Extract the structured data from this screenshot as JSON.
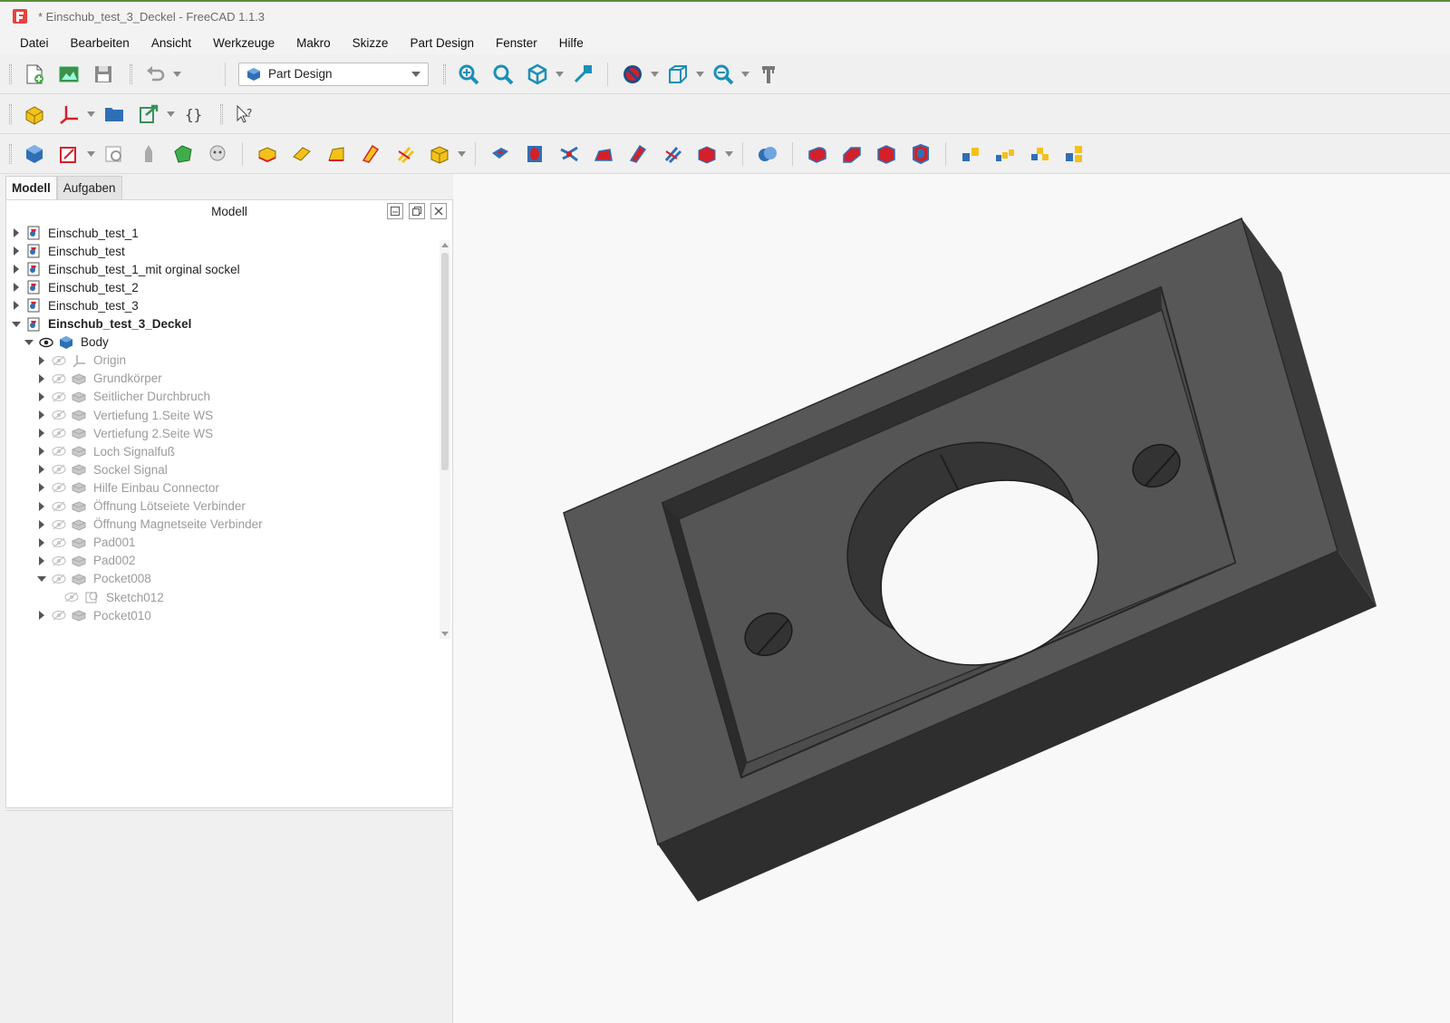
{
  "window": {
    "title": "* Einschub_test_3_Deckel - FreeCAD 1.1.3"
  },
  "menu": [
    {
      "label": "Datei"
    },
    {
      "label": "Bearbeiten"
    },
    {
      "label": "Ansicht"
    },
    {
      "label": "Werkzeuge"
    },
    {
      "label": "Makro"
    },
    {
      "label": "Skizze"
    },
    {
      "label": "Part Design"
    },
    {
      "label": "Fenster"
    },
    {
      "label": "Hilfe"
    }
  ],
  "workbench": {
    "selected": "Part Design"
  },
  "combo": {
    "tabs": [
      {
        "label": "Modell"
      },
      {
        "label": "Aufgaben"
      }
    ],
    "tree_header": "Modell"
  },
  "tree": [
    {
      "label": "Einschub_test_1",
      "type": "document",
      "expanded": false
    },
    {
      "label": "Einschub_test",
      "type": "document",
      "expanded": false
    },
    {
      "label": "Einschub_test_1_mit orginal sockel",
      "type": "document",
      "expanded": false
    },
    {
      "label": "Einschub_test_2",
      "type": "document",
      "expanded": false
    },
    {
      "label": "Einschub_test_3",
      "type": "document",
      "expanded": false
    },
    {
      "label": "Einschub_test_3_Deckel",
      "type": "document",
      "expanded": true,
      "active": true
    },
    {
      "label": "Body",
      "type": "body",
      "expanded": true,
      "visible": true
    },
    {
      "label": "Origin",
      "type": "origin",
      "visible": false
    },
    {
      "label": "Grundkörper",
      "type": "feature",
      "visible": false
    },
    {
      "label": "Seitlicher Durchbruch",
      "type": "feature",
      "visible": false
    },
    {
      "label": "Vertiefung 1.Seite WS",
      "type": "feature",
      "visible": false
    },
    {
      "label": "Vertiefung 2.Seite WS",
      "type": "feature",
      "visible": false
    },
    {
      "label": "Loch Signalfuß",
      "type": "feature",
      "visible": false
    },
    {
      "label": "Sockel Signal",
      "type": "feature",
      "visible": false
    },
    {
      "label": "Hilfe Einbau Connector",
      "type": "feature",
      "visible": false
    },
    {
      "label": "Öffnung Lötseiete Verbinder",
      "type": "feature",
      "visible": false
    },
    {
      "label": "Öffnung Magnetseite Verbinder",
      "type": "feature",
      "visible": false
    },
    {
      "label": "Pad001",
      "type": "feature",
      "visible": false
    },
    {
      "label": "Pad002",
      "type": "feature",
      "visible": false
    },
    {
      "label": "Pocket008",
      "type": "feature",
      "expanded": true,
      "visible": false
    },
    {
      "label": "Sketch012",
      "type": "sketch",
      "visible": false
    },
    {
      "label": "Pocket010",
      "type": "feature",
      "visible": false
    }
  ],
  "colors": {
    "accent_green": "#5b8f3a",
    "model_face": "#555555",
    "model_side": "#3a3a3a",
    "toolbar_blue": "#2f6fb6",
    "toolbar_yellow": "#f2c21b",
    "toolbar_red": "#d3202a"
  }
}
